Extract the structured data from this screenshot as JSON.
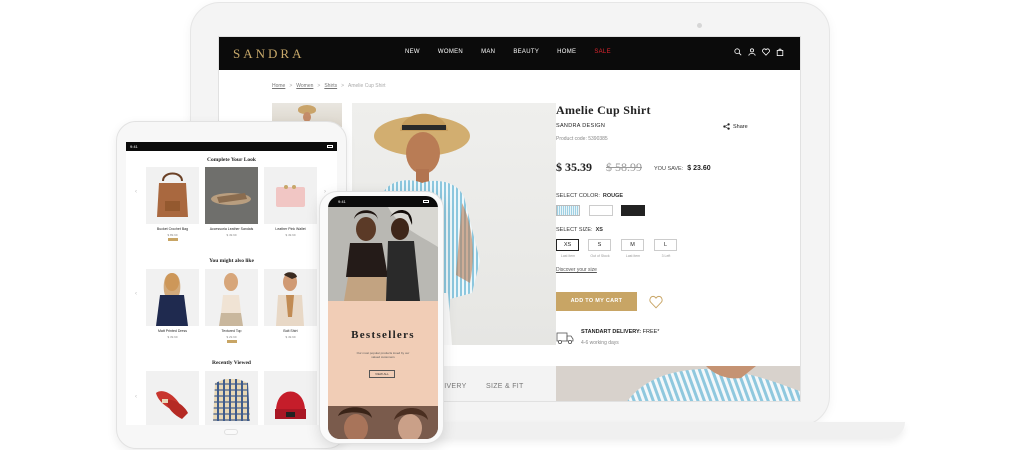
{
  "laptop": {
    "logo": "SANDRA",
    "nav": [
      "NEW",
      "WOMEN",
      "MAN",
      "BEAUTY",
      "HOME",
      "SALE"
    ],
    "breadcrumb": [
      "Home",
      "Women",
      "Shirts",
      "Amelie Cup Shirt"
    ],
    "product": {
      "title": "Amelie Cup Shirt",
      "brand": "SANDRA DESIGN",
      "code": "Product code: 5390385",
      "share": "Share",
      "price": "$ 35.39",
      "old_price": "$ 58.99",
      "you_save_label": "YOU SAVE:",
      "you_save_value": "$ 23.60",
      "color_label": "SELECT COLOR:",
      "color_value": "ROUGE",
      "size_label": "SELECT SIZE:",
      "size_value": "XS",
      "sizes": [
        {
          "label": "XS",
          "note": "Last item"
        },
        {
          "label": "S",
          "note": "Out of Stock"
        },
        {
          "label": "M",
          "note": "Last item"
        },
        {
          "label": "L",
          "note": "3 Left"
        }
      ],
      "size_guide": "Discover your size",
      "add_to_cart": "ADD TO MY CART",
      "delivery_title": "STANDART DELIVERY:",
      "delivery_price": "FREE*",
      "delivery_days": "4-6 working days"
    },
    "tabs": [
      "LIVERY",
      "SIZE & FIT"
    ]
  },
  "tablet": {
    "time": "9:41",
    "sections": [
      "Complete Your Look",
      "You might also like",
      "Recently Viewed"
    ],
    "complete_look": [
      {
        "name": "Bucket Crochet Bag",
        "price": "$ 89.99"
      },
      {
        "name": "Accessoria Leather Sandals",
        "price": "$ 49.99"
      },
      {
        "name": "Leather Pink Wallet",
        "price": "$ 49.99"
      }
    ],
    "also_like": [
      {
        "name": "Matt Printed Dress",
        "price": "$ 39.99"
      },
      {
        "name": "Textured Top",
        "price": "$ 29.99"
      },
      {
        "name": "Bolt Shirt",
        "price": "$ 49.99"
      }
    ]
  },
  "phone": {
    "time": "9:41",
    "headline": "Bestsellers",
    "subtext": "Our most popular products loved by our valued customers",
    "button": "VIEW ALL"
  },
  "colors": {
    "brand_gold": "#c8a565",
    "nav_black": "#0b0b0b",
    "sale_red": "#e0262f",
    "peach": "#f1cdb6"
  }
}
